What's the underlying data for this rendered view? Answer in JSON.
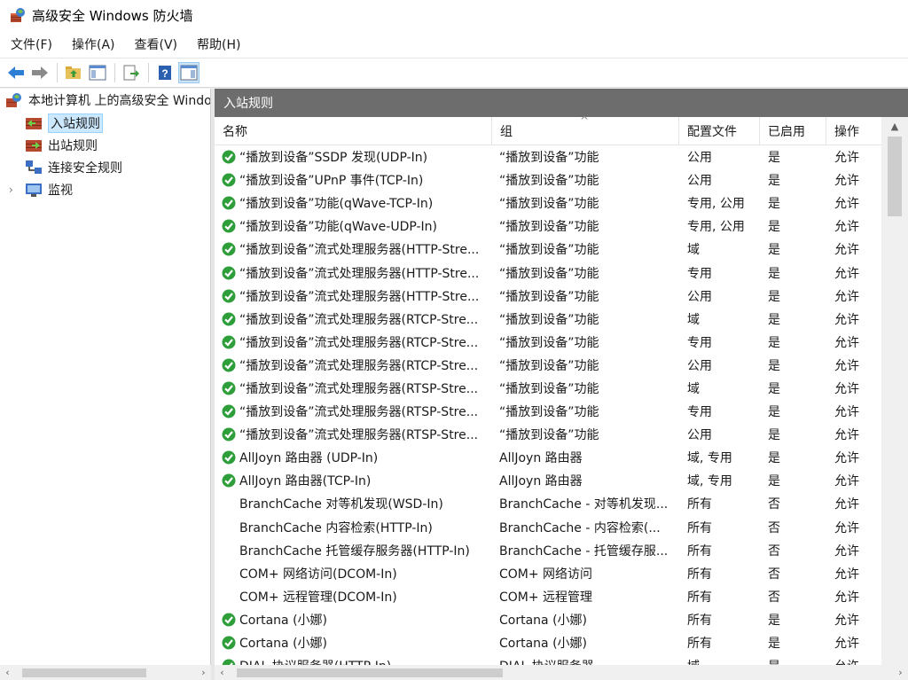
{
  "window": {
    "title": "高级安全 Windows 防火墙"
  },
  "menu": [
    "文件(F)",
    "操作(A)",
    "查看(V)",
    "帮助(H)"
  ],
  "toolbar": [
    {
      "name": "back-button",
      "icon": "back-arrow-icon"
    },
    {
      "name": "forward-button",
      "icon": "forward-arrow-icon"
    },
    {
      "name": "up-folder-button",
      "icon": "folder-up-icon"
    },
    {
      "name": "show-hide-console-tree-button",
      "icon": "console-tree-icon"
    },
    {
      "name": "export-list-button",
      "icon": "export-icon"
    },
    {
      "name": "help-button",
      "icon": "help-icon"
    },
    {
      "name": "show-hide-action-pane-button",
      "icon": "action-pane-icon"
    }
  ],
  "tree": {
    "root": "本地计算机 上的高级安全 Windows 防火墙",
    "items": [
      {
        "label": "入站规则",
        "selected": true,
        "icon": "inbound-rules-icon"
      },
      {
        "label": "出站规则",
        "selected": false,
        "icon": "outbound-rules-icon"
      },
      {
        "label": "连接安全规则",
        "selected": false,
        "icon": "connection-security-icon"
      },
      {
        "label": "监视",
        "selected": false,
        "icon": "monitor-icon",
        "expandable": true
      }
    ]
  },
  "pane": {
    "title": "入站规则",
    "columns": [
      "名称",
      "组",
      "配置文件",
      "已启用",
      "操作"
    ],
    "rows": [
      {
        "enabled_icon": true,
        "name": "“播放到设备”SSDP 发现(UDP-In)",
        "group": "“播放到设备”功能",
        "profile": "公用",
        "enabled": "是",
        "action": "允许"
      },
      {
        "enabled_icon": true,
        "name": "“播放到设备”UPnP 事件(TCP-In)",
        "group": "“播放到设备”功能",
        "profile": "公用",
        "enabled": "是",
        "action": "允许"
      },
      {
        "enabled_icon": true,
        "name": "“播放到设备”功能(qWave-TCP-In)",
        "group": "“播放到设备”功能",
        "profile": "专用, 公用",
        "enabled": "是",
        "action": "允许"
      },
      {
        "enabled_icon": true,
        "name": "“播放到设备”功能(qWave-UDP-In)",
        "group": "“播放到设备”功能",
        "profile": "专用, 公用",
        "enabled": "是",
        "action": "允许"
      },
      {
        "enabled_icon": true,
        "name": "“播放到设备”流式处理服务器(HTTP-Stre...",
        "group": "“播放到设备”功能",
        "profile": "域",
        "enabled": "是",
        "action": "允许"
      },
      {
        "enabled_icon": true,
        "name": "“播放到设备”流式处理服务器(HTTP-Stre...",
        "group": "“播放到设备”功能",
        "profile": "专用",
        "enabled": "是",
        "action": "允许"
      },
      {
        "enabled_icon": true,
        "name": "“播放到设备”流式处理服务器(HTTP-Stre...",
        "group": "“播放到设备”功能",
        "profile": "公用",
        "enabled": "是",
        "action": "允许"
      },
      {
        "enabled_icon": true,
        "name": "“播放到设备”流式处理服务器(RTCP-Stre...",
        "group": "“播放到设备”功能",
        "profile": "域",
        "enabled": "是",
        "action": "允许"
      },
      {
        "enabled_icon": true,
        "name": "“播放到设备”流式处理服务器(RTCP-Stre...",
        "group": "“播放到设备”功能",
        "profile": "专用",
        "enabled": "是",
        "action": "允许"
      },
      {
        "enabled_icon": true,
        "name": "“播放到设备”流式处理服务器(RTCP-Stre...",
        "group": "“播放到设备”功能",
        "profile": "公用",
        "enabled": "是",
        "action": "允许"
      },
      {
        "enabled_icon": true,
        "name": "“播放到设备”流式处理服务器(RTSP-Stre...",
        "group": "“播放到设备”功能",
        "profile": "域",
        "enabled": "是",
        "action": "允许"
      },
      {
        "enabled_icon": true,
        "name": "“播放到设备”流式处理服务器(RTSP-Stre...",
        "group": "“播放到设备”功能",
        "profile": "专用",
        "enabled": "是",
        "action": "允许"
      },
      {
        "enabled_icon": true,
        "name": "“播放到设备”流式处理服务器(RTSP-Stre...",
        "group": "“播放到设备”功能",
        "profile": "公用",
        "enabled": "是",
        "action": "允许"
      },
      {
        "enabled_icon": true,
        "name": "AllJoyn 路由器 (UDP-In)",
        "group": "AllJoyn 路由器",
        "profile": "域, 专用",
        "enabled": "是",
        "action": "允许"
      },
      {
        "enabled_icon": true,
        "name": "AllJoyn 路由器(TCP-In)",
        "group": "AllJoyn 路由器",
        "profile": "域, 专用",
        "enabled": "是",
        "action": "允许"
      },
      {
        "enabled_icon": false,
        "name": "BranchCache 对等机发现(WSD-In)",
        "group": "BranchCache - 对等机发现...",
        "profile": "所有",
        "enabled": "否",
        "action": "允许"
      },
      {
        "enabled_icon": false,
        "name": "BranchCache 内容检索(HTTP-In)",
        "group": "BranchCache - 内容检索(...",
        "profile": "所有",
        "enabled": "否",
        "action": "允许"
      },
      {
        "enabled_icon": false,
        "name": "BranchCache 托管缓存服务器(HTTP-In)",
        "group": "BranchCache - 托管缓存服...",
        "profile": "所有",
        "enabled": "否",
        "action": "允许"
      },
      {
        "enabled_icon": false,
        "name": "COM+ 网络访问(DCOM-In)",
        "group": "COM+ 网络访问",
        "profile": "所有",
        "enabled": "否",
        "action": "允许"
      },
      {
        "enabled_icon": false,
        "name": "COM+ 远程管理(DCOM-In)",
        "group": "COM+ 远程管理",
        "profile": "所有",
        "enabled": "否",
        "action": "允许"
      },
      {
        "enabled_icon": true,
        "name": "Cortana (小娜)",
        "group": "Cortana (小娜)",
        "profile": "所有",
        "enabled": "是",
        "action": "允许"
      },
      {
        "enabled_icon": true,
        "name": "Cortana (小娜)",
        "group": "Cortana (小娜)",
        "profile": "所有",
        "enabled": "是",
        "action": "允许"
      },
      {
        "enabled_icon": true,
        "name": "DIAL 协议服务器(HTTP-In)",
        "group": "DIAL 协议服务器",
        "profile": "域",
        "enabled": "是",
        "action": "允许"
      }
    ]
  },
  "colors": {
    "enabled_check": "#2e9e3a",
    "pane_header": "#6d6d6d",
    "selection": "#cce8ff"
  }
}
